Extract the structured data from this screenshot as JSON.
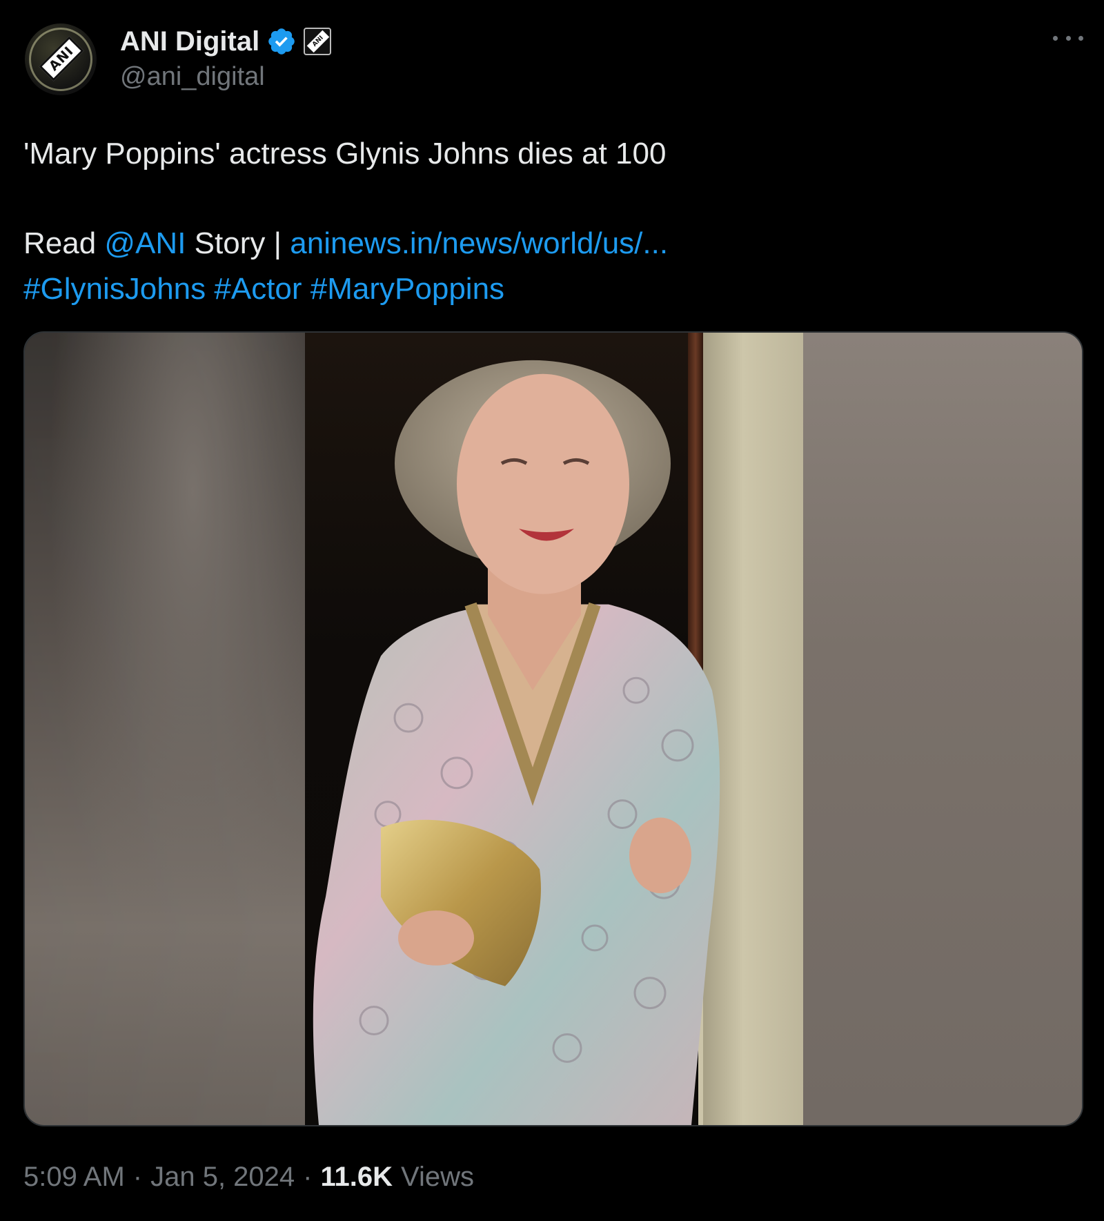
{
  "author": {
    "display_name": "ANI Digital",
    "handle": "@ani_digital",
    "avatar_text": "ANI",
    "affiliate_badge_text": "ANI"
  },
  "tweet": {
    "headline": "'Mary Poppins' actress Glynis Johns dies at 100",
    "read": "Read",
    "mention": "@ANI",
    "story": "Story |",
    "url": "aninews.in/news/world/us/...",
    "hashtags": [
      "#GlynisJohns",
      "#Actor",
      "#MaryPoppins"
    ]
  },
  "meta": {
    "time": "5:09 AM",
    "separator": "·",
    "date": "Jan 5, 2024",
    "views_count": "11.6K",
    "views_label": "Views"
  },
  "colors": {
    "background": "#000000",
    "text": "#e7e9ea",
    "secondary": "#71767b",
    "link": "#1d9bf0",
    "verified": "#1d9bf0"
  },
  "icons": {
    "verified": "verified-badge-icon",
    "more": "more-options-icon"
  }
}
